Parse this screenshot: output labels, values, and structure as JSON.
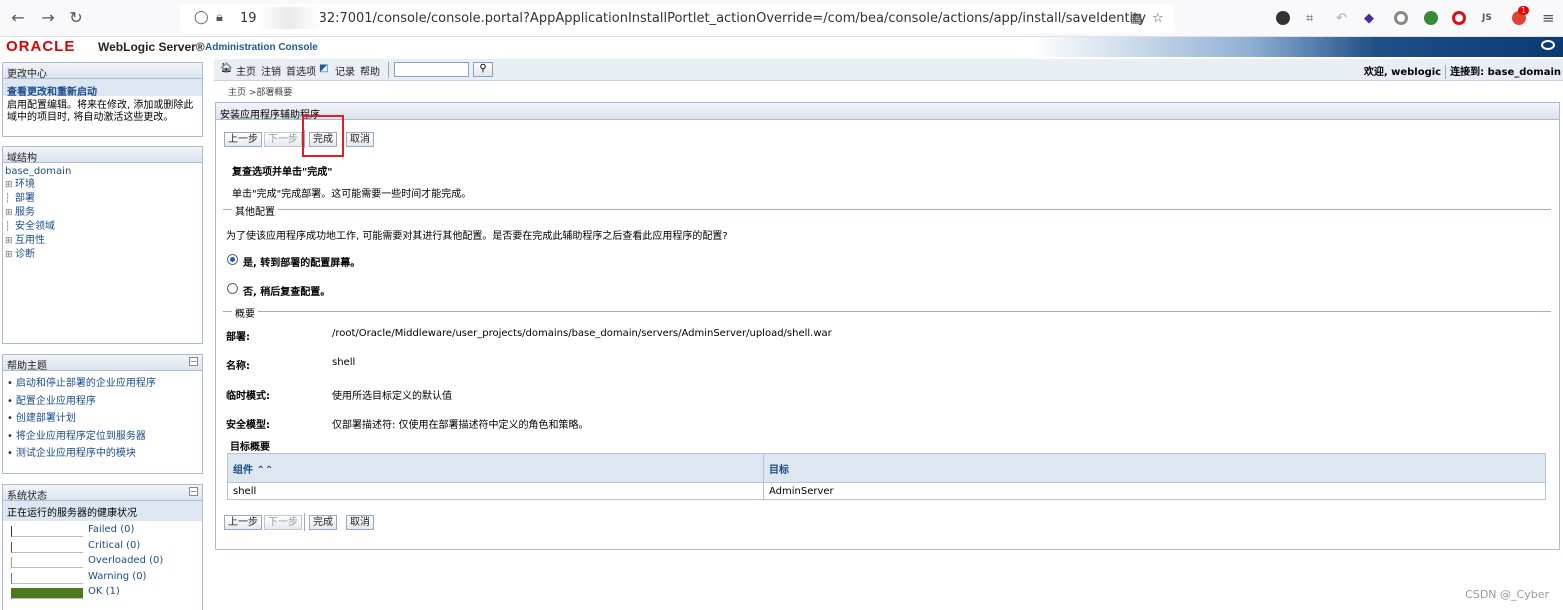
{
  "browser": {
    "url_prefix": "19",
    "url_rest": "32:7001/console/console.portal?AppApplicationInstallPortlet_actionOverride=/com/bea/console/actions/app/install/saveIdentity",
    "ext_profile": "JS",
    "notification_count": "1"
  },
  "header": {
    "oracle": "ORACLE",
    "product": "WebLogic Server®",
    "console": "Administration Console"
  },
  "toolbar": {
    "home": "主页",
    "logout": "注销",
    "preferences": "首选项",
    "record": "记录",
    "help": "帮助",
    "search_value": "",
    "welcome": "欢迎, weblogic",
    "connected": "连接到: base_domain"
  },
  "breadcrumb": "主页 >部署概要",
  "change_center": {
    "title": "更改中心",
    "sub": "查看更改和重新启动",
    "text": "启用配置编辑。将来在修改, 添加或删除此域中的项目时, 将自动激活这些更改。"
  },
  "domain_structure": {
    "title": "域结构",
    "root": "base_domain",
    "items": [
      {
        "exp": "⊞",
        "label": "环境"
      },
      {
        "exp": "┆",
        "label": "部署"
      },
      {
        "exp": "⊞",
        "label": "服务"
      },
      {
        "exp": "┆",
        "label": "安全领域"
      },
      {
        "exp": "⊞",
        "label": "互用性"
      },
      {
        "exp": "⊞",
        "label": "诊断"
      }
    ]
  },
  "help_topics": {
    "title": "帮助主题",
    "items": [
      "启动和停止部署的企业应用程序",
      "配置企业应用程序",
      "创建部署计划",
      "将企业应用程序定位到服务器",
      "测试企业应用程序中的模块"
    ]
  },
  "system_status": {
    "title": "系统状态",
    "sub": "正在运行的服务器的健康状况",
    "rows": [
      {
        "label": "Failed (0)",
        "color": "#333333",
        "fill": 0
      },
      {
        "label": "Critical (0)",
        "color": "#cc2222",
        "fill": 0
      },
      {
        "label": "Overloaded (0)",
        "color": "#d9a030",
        "fill": 0
      },
      {
        "label": "Warning (0)",
        "color": "#4a8aa0",
        "fill": 0
      },
      {
        "label": "OK (1)",
        "color": "#4e7a1e",
        "fill": 1
      }
    ]
  },
  "wizard": {
    "title": "安装应用程序辅助程序",
    "back": "上一步",
    "next": "下一步",
    "finish": "完成",
    "cancel": "取消",
    "review_heading": "复查选项并单击\"完成\"",
    "review_text": "单击\"完成\"完成部署。这可能需要一些时间才能完成。",
    "other_config_label": "其他配置",
    "other_config_question": "为了使该应用程序成功地工作, 可能需要对其进行其他配置。是否要在完成此辅助程序之后查看此应用程序的配置?",
    "option_yes": "是, 转到部署的配置屏幕。",
    "option_no": "否, 稍后复查配置。",
    "summary_label": "概要",
    "summary": [
      {
        "key": "部署:",
        "value": "/root/Oracle/Middleware/user_projects/domains/base_domain/servers/AdminServer/upload/shell.war"
      },
      {
        "key": "名称:",
        "value": "shell"
      },
      {
        "key": "临时模式:",
        "value": "使用所选目标定义的默认值"
      },
      {
        "key": "安全模型:",
        "value": "仅部署描述符: 仅使用在部署描述符中定义的角色和策略。"
      }
    ],
    "target_summary": "目标概要",
    "table": {
      "col_component": "组件 ⌃⌃",
      "col_target": "目标",
      "rows": [
        {
          "component": "shell",
          "target": "AdminServer"
        }
      ]
    }
  },
  "watermark": "CSDN @_Cyber"
}
